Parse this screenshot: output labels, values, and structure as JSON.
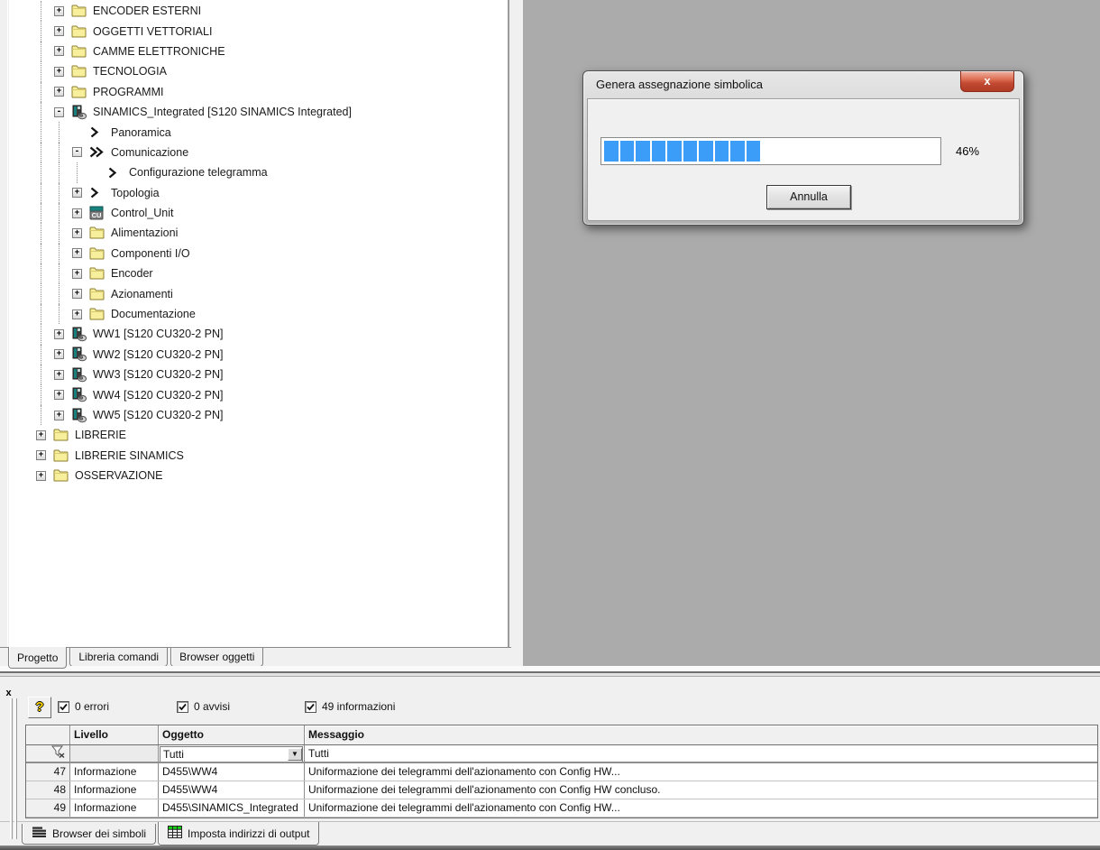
{
  "colors": {
    "workspace_gray": "#ABABAB",
    "panel_face": "#F0F0F0",
    "progress_blue": "#3B9DF8",
    "folder_yellow": "#F8EF9C",
    "device_teal": "#18827E",
    "close_red": "#C24A33"
  },
  "tree": {
    "items": [
      {
        "label": "ENCODER ESTERNI",
        "level": 1,
        "icon": "folder",
        "expand": "+"
      },
      {
        "label": "OGGETTI VETTORIALI",
        "level": 1,
        "icon": "folder",
        "expand": "+"
      },
      {
        "label": "CAMME ELETTRONICHE",
        "level": 1,
        "icon": "folder",
        "expand": "+"
      },
      {
        "label": "TECNOLOGIA",
        "level": 1,
        "icon": "folder",
        "expand": "+"
      },
      {
        "label": "PROGRAMMI",
        "level": 1,
        "icon": "folder",
        "expand": "+"
      },
      {
        "label": "SINAMICS_Integrated [S120 SINAMICS Integrated]",
        "level": 1,
        "icon": "device",
        "expand": "-"
      },
      {
        "label": "Panoramica",
        "level": 2,
        "icon": "chevron",
        "expand": null
      },
      {
        "label": "Comunicazione",
        "level": 2,
        "icon": "chevron2",
        "expand": "-"
      },
      {
        "label": "Configurazione telegramma",
        "level": 3,
        "icon": "chevron",
        "expand": null
      },
      {
        "label": "Topologia",
        "level": 2,
        "icon": "chevron",
        "expand": "+"
      },
      {
        "label": "Control_Unit",
        "level": 2,
        "icon": "cu",
        "expand": "+"
      },
      {
        "label": "Alimentazioni",
        "level": 2,
        "icon": "folder",
        "expand": "+"
      },
      {
        "label": "Componenti I/O",
        "level": 2,
        "icon": "folder",
        "expand": "+"
      },
      {
        "label": "Encoder",
        "level": 2,
        "icon": "folder",
        "expand": "+"
      },
      {
        "label": "Azionamenti",
        "level": 2,
        "icon": "folder",
        "expand": "+"
      },
      {
        "label": "Documentazione",
        "level": 2,
        "icon": "folder",
        "expand": "+"
      },
      {
        "label": "WW1 [S120 CU320-2 PN]",
        "level": 1,
        "icon": "device",
        "expand": "+"
      },
      {
        "label": "WW2 [S120 CU320-2 PN]",
        "level": 1,
        "icon": "device",
        "expand": "+"
      },
      {
        "label": "WW3 [S120 CU320-2 PN]",
        "level": 1,
        "icon": "device",
        "expand": "+"
      },
      {
        "label": "WW4 [S120 CU320-2 PN]",
        "level": 1,
        "icon": "device",
        "expand": "+"
      },
      {
        "label": "WW5 [S120 CU320-2 PN]",
        "level": 1,
        "icon": "device",
        "expand": "+"
      },
      {
        "label": "LIBRERIE",
        "level": 0,
        "icon": "folder",
        "expand": "+"
      },
      {
        "label": "LIBRERIE SINAMICS",
        "level": 0,
        "icon": "folder",
        "expand": "+"
      },
      {
        "label": "OSSERVAZIONE",
        "level": 0,
        "icon": "folder",
        "expand": "+"
      }
    ],
    "tabs": [
      {
        "label": "Progetto",
        "active": true
      },
      {
        "label": "Libreria comandi",
        "active": false
      },
      {
        "label": "Browser oggetti",
        "active": false
      }
    ]
  },
  "dialog": {
    "title": "Genera assegnazione simbolica",
    "close_glyph": "x",
    "progress_percent": "46%",
    "progress_blocks": 10,
    "cancel_label": "Annulla"
  },
  "output": {
    "close_glyph": "x",
    "help_glyph": "?",
    "filters": [
      {
        "label": "0 errori",
        "checked": true
      },
      {
        "label": "0 avvisi",
        "checked": true
      },
      {
        "label": "49 informazioni",
        "checked": true
      }
    ],
    "table": {
      "headers": [
        "",
        "Livello",
        "Oggetto",
        "Messaggio"
      ],
      "filter_row": {
        "oggetto": "Tutti",
        "messaggio": "Tutti"
      },
      "rows": [
        {
          "num": "47",
          "livello": "Informazione",
          "oggetto": "D455\\WW4",
          "messaggio": "Uniformazione dei telegrammi dell'azionamento con Config HW..."
        },
        {
          "num": "48",
          "livello": "Informazione",
          "oggetto": "D455\\WW4",
          "messaggio": "Uniformazione dei telegrammi dell'azionamento con Config HW concluso."
        },
        {
          "num": "49",
          "livello": "Informazione",
          "oggetto": "D455\\SINAMICS_Integrated",
          "messaggio": "Uniformazione dei telegrammi dell'azionamento con Config HW..."
        }
      ]
    },
    "tabs": [
      {
        "label": "Browser dei simboli",
        "icon": "symbol-browser-icon",
        "active": false
      },
      {
        "label": "Imposta indirizzi di output",
        "icon": "output-table-icon",
        "active": true
      }
    ]
  }
}
